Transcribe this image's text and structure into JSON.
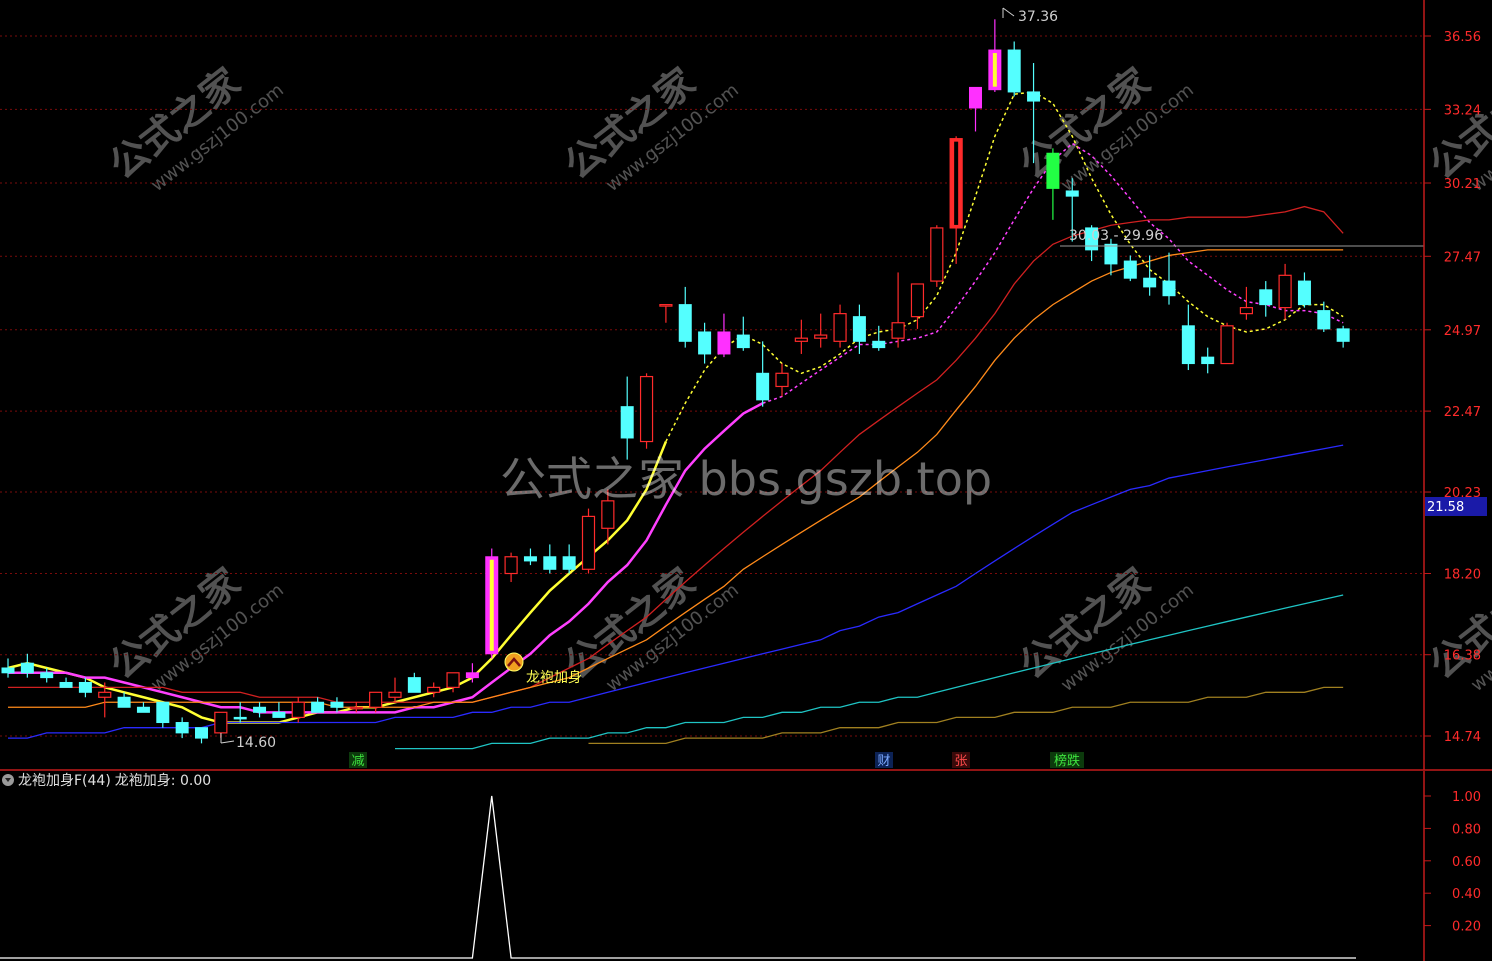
{
  "colors": {
    "background": "#000000",
    "up": "#ff2b2b",
    "down": "#54ffff",
    "dragon": "#ff30ff",
    "axis": "#c21a1a",
    "grid": "#7a0b0b",
    "ma5": "#ffff33",
    "ma10": "#ff40ff",
    "ma20": "#d02020",
    "ma30": "#ff8a1a",
    "ma60": "#2a2aff",
    "ma120": "#1fc4c4",
    "ma250": "#a08020"
  },
  "main_chart": {
    "price_axis_labels": [
      "36.56",
      "33.24",
      "30.21",
      "27.47",
      "24.97",
      "22.47",
      "20.23",
      "18.20",
      "16.38",
      "14.74"
    ],
    "current_price_tag": "21.58",
    "high_marker": "37.36",
    "low_marker": "14.60",
    "crosshair_label": "30.03 - 29.96",
    "signal_label": "龙袍加身",
    "signal_icon": "signal-arrow-up-icon",
    "event_tags": [
      {
        "text": "减",
        "color": "#1fbf1f"
      },
      {
        "text": "财",
        "color": "#2a6ad0"
      },
      {
        "text": "张",
        "color": "#d02020"
      },
      {
        "text": "榜跌",
        "color": "#1fbf1f"
      }
    ],
    "watermark_center": "公式之家 bbs.gszb.top",
    "watermark_tile_title": "公式之家",
    "watermark_tile_url": "www.gszj100.com"
  },
  "indicator_panel": {
    "toggle_icon": "chevron-down-icon",
    "name": "龙袍加身F(44)",
    "value_label": "龙袍加身: 0.00",
    "axis_labels": [
      "1.00",
      "0.80",
      "0.60",
      "0.40",
      "0.20"
    ]
  },
  "chart_data": {
    "type": "candlestick",
    "title": "",
    "xlabel": "",
    "ylabel": "",
    "ylim": [
      14.0,
      38.0
    ],
    "y_scale": "log",
    "grid": true,
    "candles": [
      {
        "o": 16.1,
        "h": 16.3,
        "l": 15.9,
        "c": 16.0,
        "kind": "down"
      },
      {
        "o": 16.2,
        "h": 16.4,
        "l": 15.9,
        "c": 16.0,
        "kind": "down"
      },
      {
        "o": 16.0,
        "h": 16.1,
        "l": 15.8,
        "c": 15.9,
        "kind": "down"
      },
      {
        "o": 15.8,
        "h": 15.9,
        "l": 15.7,
        "c": 15.7,
        "kind": "down"
      },
      {
        "o": 15.8,
        "h": 15.9,
        "l": 15.5,
        "c": 15.6,
        "kind": "down"
      },
      {
        "o": 15.6,
        "h": 15.8,
        "l": 15.1,
        "c": 15.5,
        "kind": "up"
      },
      {
        "o": 15.5,
        "h": 15.6,
        "l": 15.3,
        "c": 15.3,
        "kind": "down"
      },
      {
        "o": 15.3,
        "h": 15.4,
        "l": 15.2,
        "c": 15.2,
        "kind": "down"
      },
      {
        "o": 15.4,
        "h": 15.4,
        "l": 14.9,
        "c": 15.0,
        "kind": "down"
      },
      {
        "o": 15.0,
        "h": 15.1,
        "l": 14.7,
        "c": 14.8,
        "kind": "down"
      },
      {
        "o": 14.9,
        "h": 14.9,
        "l": 14.6,
        "c": 14.7,
        "kind": "down"
      },
      {
        "o": 14.8,
        "h": 15.2,
        "l": 14.7,
        "c": 15.2,
        "kind": "up"
      },
      {
        "o": 15.1,
        "h": 15.4,
        "l": 15.0,
        "c": 15.1,
        "kind": "down"
      },
      {
        "o": 15.3,
        "h": 15.4,
        "l": 15.1,
        "c": 15.2,
        "kind": "down"
      },
      {
        "o": 15.2,
        "h": 15.4,
        "l": 15.1,
        "c": 15.1,
        "kind": "down"
      },
      {
        "o": 15.1,
        "h": 15.5,
        "l": 15.0,
        "c": 15.4,
        "kind": "up"
      },
      {
        "o": 15.4,
        "h": 15.5,
        "l": 15.2,
        "c": 15.2,
        "kind": "down"
      },
      {
        "o": 15.4,
        "h": 15.5,
        "l": 15.2,
        "c": 15.3,
        "kind": "down"
      },
      {
        "o": 15.3,
        "h": 15.4,
        "l": 15.2,
        "c": 15.3,
        "kind": "up"
      },
      {
        "o": 15.3,
        "h": 15.6,
        "l": 15.2,
        "c": 15.6,
        "kind": "up"
      },
      {
        "o": 15.5,
        "h": 15.9,
        "l": 15.4,
        "c": 15.6,
        "kind": "up"
      },
      {
        "o": 15.9,
        "h": 16.0,
        "l": 15.6,
        "c": 15.6,
        "kind": "down"
      },
      {
        "o": 15.6,
        "h": 15.8,
        "l": 15.5,
        "c": 15.7,
        "kind": "up"
      },
      {
        "o": 15.7,
        "h": 16.0,
        "l": 15.6,
        "c": 16.0,
        "kind": "up"
      },
      {
        "o": 16.0,
        "h": 16.2,
        "l": 15.8,
        "c": 15.9,
        "kind": "dragon"
      },
      {
        "o": 16.4,
        "h": 18.8,
        "l": 16.3,
        "c": 18.6,
        "kind": "dragon"
      },
      {
        "o": 18.2,
        "h": 18.7,
        "l": 18.0,
        "c": 18.6,
        "kind": "up"
      },
      {
        "o": 18.6,
        "h": 18.8,
        "l": 18.4,
        "c": 18.5,
        "kind": "down"
      },
      {
        "o": 18.6,
        "h": 18.9,
        "l": 18.2,
        "c": 18.3,
        "kind": "down"
      },
      {
        "o": 18.6,
        "h": 18.9,
        "l": 18.2,
        "c": 18.3,
        "kind": "down"
      },
      {
        "o": 18.3,
        "h": 19.8,
        "l": 18.2,
        "c": 19.6,
        "kind": "up"
      },
      {
        "o": 19.3,
        "h": 20.3,
        "l": 18.9,
        "c": 20.0,
        "kind": "up"
      },
      {
        "o": 22.6,
        "h": 23.5,
        "l": 21.1,
        "c": 21.7,
        "kind": "down"
      },
      {
        "o": 21.6,
        "h": 23.6,
        "l": 21.4,
        "c": 23.5,
        "kind": "up"
      },
      {
        "o": 25.8,
        "h": 25.8,
        "l": 25.2,
        "c": 25.8,
        "kind": "up"
      },
      {
        "o": 25.8,
        "h": 26.4,
        "l": 24.4,
        "c": 24.6,
        "kind": "down"
      },
      {
        "o": 24.9,
        "h": 25.2,
        "l": 23.9,
        "c": 24.2,
        "kind": "down"
      },
      {
        "o": 24.2,
        "h": 25.5,
        "l": 24.1,
        "c": 24.9,
        "kind": "dragon"
      },
      {
        "o": 24.8,
        "h": 25.4,
        "l": 24.3,
        "c": 24.4,
        "kind": "down"
      },
      {
        "o": 23.6,
        "h": 24.6,
        "l": 22.6,
        "c": 22.8,
        "kind": "down"
      },
      {
        "o": 23.2,
        "h": 23.9,
        "l": 22.9,
        "c": 23.6,
        "kind": "up"
      },
      {
        "o": 24.6,
        "h": 25.3,
        "l": 24.2,
        "c": 24.7,
        "kind": "up"
      },
      {
        "o": 24.7,
        "h": 25.5,
        "l": 24.4,
        "c": 24.8,
        "kind": "up"
      },
      {
        "o": 24.6,
        "h": 25.8,
        "l": 24.4,
        "c": 25.5,
        "kind": "up"
      },
      {
        "o": 25.4,
        "h": 25.8,
        "l": 24.2,
        "c": 24.6,
        "kind": "down"
      },
      {
        "o": 24.6,
        "h": 25.1,
        "l": 24.3,
        "c": 24.4,
        "kind": "down"
      },
      {
        "o": 24.7,
        "h": 26.9,
        "l": 24.4,
        "c": 25.2,
        "kind": "up"
      },
      {
        "o": 25.4,
        "h": 26.5,
        "l": 25.0,
        "c": 26.5,
        "kind": "up"
      },
      {
        "o": 26.6,
        "h": 28.6,
        "l": 26.4,
        "c": 28.5,
        "kind": "up"
      },
      {
        "o": 28.5,
        "h": 32.1,
        "l": 27.2,
        "c": 32.0,
        "kind": "up"
      },
      {
        "o": 33.3,
        "h": 34.2,
        "l": 32.3,
        "c": 34.2,
        "kind": "dragon"
      },
      {
        "o": 34.1,
        "h": 37.36,
        "l": 34.0,
        "c": 35.9,
        "kind": "dragon"
      },
      {
        "o": 35.9,
        "h": 36.3,
        "l": 33.8,
        "c": 34.0,
        "kind": "down"
      },
      {
        "o": 34.0,
        "h": 35.3,
        "l": 31.0,
        "c": 33.6,
        "kind": "down"
      },
      {
        "o": 31.4,
        "h": 31.6,
        "l": 28.8,
        "c": 30.0,
        "kind": "green"
      },
      {
        "o": 29.9,
        "h": 30.4,
        "l": 28.0,
        "c": 29.7,
        "kind": "down"
      },
      {
        "o": 28.5,
        "h": 28.6,
        "l": 27.3,
        "c": 27.7,
        "kind": "down"
      },
      {
        "o": 27.9,
        "h": 28.1,
        "l": 26.8,
        "c": 27.2,
        "kind": "down"
      },
      {
        "o": 27.3,
        "h": 27.5,
        "l": 26.6,
        "c": 26.7,
        "kind": "down"
      },
      {
        "o": 26.7,
        "h": 27.5,
        "l": 26.1,
        "c": 26.4,
        "kind": "down"
      },
      {
        "o": 26.6,
        "h": 27.6,
        "l": 25.8,
        "c": 26.1,
        "kind": "down"
      },
      {
        "o": 25.1,
        "h": 25.8,
        "l": 23.7,
        "c": 23.9,
        "kind": "down"
      },
      {
        "o": 24.1,
        "h": 24.4,
        "l": 23.6,
        "c": 23.9,
        "kind": "down"
      },
      {
        "o": 23.9,
        "h": 25.2,
        "l": 23.9,
        "c": 25.1,
        "kind": "up"
      },
      {
        "o": 25.5,
        "h": 26.4,
        "l": 25.3,
        "c": 25.7,
        "kind": "up"
      },
      {
        "o": 25.8,
        "h": 26.6,
        "l": 25.4,
        "c": 26.3,
        "kind": "down"
      },
      {
        "o": 25.7,
        "h": 27.2,
        "l": 25.3,
        "c": 26.8,
        "kind": "up"
      },
      {
        "o": 26.6,
        "h": 26.9,
        "l": 25.7,
        "c": 25.8,
        "kind": "down"
      },
      {
        "o": 25.6,
        "h": 25.9,
        "l": 24.9,
        "c": 25.0,
        "kind": "down"
      },
      {
        "o": 25.0,
        "h": 25.1,
        "l": 24.4,
        "c": 24.6,
        "kind": "down"
      }
    ],
    "series": [
      {
        "color_key": "ma5",
        "dashed_tail_from": 35,
        "values": [
          16.1,
          16.2,
          16.1,
          16.0,
          15.9,
          15.7,
          15.6,
          15.5,
          15.4,
          15.3,
          15.1,
          15.0,
          15.0,
          15.0,
          15.0,
          15.1,
          15.2,
          15.2,
          15.3,
          15.3,
          15.4,
          15.5,
          15.6,
          15.7,
          15.9,
          16.3,
          16.8,
          17.3,
          17.8,
          18.2,
          18.6,
          19.0,
          19.5,
          20.3,
          21.6,
          22.7,
          23.7,
          24.4,
          24.8,
          24.5,
          23.9,
          23.6,
          23.8,
          24.2,
          24.7,
          24.9,
          25.0,
          25.3,
          26.1,
          27.6,
          29.7,
          32.1,
          33.9,
          34.0,
          33.5,
          32.1,
          30.4,
          29.0,
          27.9,
          27.0,
          26.5,
          25.9,
          25.4,
          25.1,
          24.9,
          25.0,
          25.3,
          25.8,
          25.8,
          25.4
        ]
      },
      {
        "color_key": "ma10",
        "dashed_tail_from": 40,
        "values": [
          16.0,
          16.0,
          16.0,
          16.0,
          15.9,
          15.9,
          15.8,
          15.7,
          15.6,
          15.5,
          15.4,
          15.3,
          15.3,
          15.2,
          15.2,
          15.2,
          15.2,
          15.2,
          15.2,
          15.2,
          15.2,
          15.3,
          15.3,
          15.4,
          15.5,
          15.8,
          16.1,
          16.4,
          16.8,
          17.1,
          17.5,
          18.0,
          18.4,
          19.0,
          19.9,
          20.8,
          21.4,
          21.9,
          22.4,
          22.7,
          22.9,
          23.3,
          23.7,
          24.1,
          24.5,
          24.5,
          24.6,
          24.7,
          24.9,
          25.7,
          26.6,
          27.6,
          28.8,
          30.0,
          31.1,
          31.8,
          31.3,
          30.5,
          29.6,
          28.7,
          28.1,
          27.3,
          26.8,
          26.3,
          25.9,
          25.8,
          25.6,
          25.6,
          25.5,
          25.2
        ]
      },
      {
        "color_key": "ma20",
        "values": [
          15.7,
          15.7,
          15.7,
          15.7,
          15.7,
          15.7,
          15.7,
          15.7,
          15.7,
          15.6,
          15.6,
          15.6,
          15.6,
          15.5,
          15.5,
          15.5,
          15.5,
          15.4,
          15.4,
          15.4,
          15.4,
          15.4,
          15.4,
          15.4,
          15.4,
          15.5,
          15.6,
          15.7,
          15.9,
          16.1,
          16.3,
          16.6,
          16.9,
          17.2,
          17.6,
          18.0,
          18.4,
          18.8,
          19.2,
          19.6,
          20.0,
          20.4,
          20.8,
          21.3,
          21.8,
          22.2,
          22.6,
          23.0,
          23.4,
          24.0,
          24.7,
          25.5,
          26.5,
          27.3,
          27.9,
          28.2,
          28.4,
          28.6,
          28.7,
          28.8,
          28.8,
          28.9,
          28.9,
          28.9,
          28.9,
          29.0,
          29.1,
          29.3,
          29.1,
          28.3
        ]
      },
      {
        "color_key": "ma30",
        "values": [
          15.3,
          15.3,
          15.3,
          15.3,
          15.3,
          15.4,
          15.4,
          15.4,
          15.4,
          15.4,
          15.4,
          15.4,
          15.4,
          15.4,
          15.4,
          15.4,
          15.4,
          15.3,
          15.3,
          15.3,
          15.3,
          15.3,
          15.4,
          15.4,
          15.4,
          15.5,
          15.6,
          15.7,
          15.8,
          15.9,
          16.1,
          16.3,
          16.5,
          16.7,
          17.0,
          17.3,
          17.6,
          17.9,
          18.3,
          18.6,
          18.9,
          19.2,
          19.5,
          19.8,
          20.1,
          20.5,
          20.9,
          21.3,
          21.8,
          22.5,
          23.2,
          24.0,
          24.7,
          25.3,
          25.8,
          26.2,
          26.6,
          26.9,
          27.1,
          27.3,
          27.5,
          27.6,
          27.7,
          27.7,
          27.7,
          27.7,
          27.7,
          27.7,
          27.7,
          27.7
        ]
      },
      {
        "color_key": "ma60",
        "values": [
          14.7,
          14.7,
          14.8,
          14.8,
          14.8,
          14.8,
          14.9,
          14.9,
          14.9,
          14.9,
          14.9,
          15.0,
          15.0,
          15.0,
          15.0,
          15.0,
          15.0,
          15.0,
          15.0,
          15.0,
          15.1,
          15.1,
          15.1,
          15.1,
          15.2,
          15.2,
          15.3,
          15.3,
          15.4,
          15.4,
          15.5,
          15.6,
          15.7,
          15.8,
          15.9,
          16.0,
          16.1,
          16.2,
          16.3,
          16.4,
          16.5,
          16.6,
          16.7,
          16.9,
          17.0,
          17.2,
          17.3,
          17.5,
          17.7,
          17.9,
          18.2,
          18.5,
          18.8,
          19.1,
          19.4,
          19.7,
          19.9,
          20.1,
          20.3,
          20.4,
          20.6,
          20.7,
          20.8,
          20.9,
          21.0,
          21.1,
          21.2,
          21.3,
          21.4,
          21.5
        ]
      },
      {
        "color_key": "ma120",
        "start": 20,
        "values": [
          14.5,
          14.5,
          14.5,
          14.5,
          14.5,
          14.6,
          14.6,
          14.6,
          14.7,
          14.7,
          14.7,
          14.8,
          14.8,
          14.9,
          14.9,
          15.0,
          15.0,
          15.0,
          15.1,
          15.1,
          15.2,
          15.2,
          15.3,
          15.3,
          15.4,
          15.4,
          15.5,
          15.5,
          15.6,
          15.7,
          15.8,
          15.9,
          16.0,
          16.1,
          16.2,
          16.3,
          16.4,
          16.5,
          16.6,
          16.7,
          16.8,
          16.9,
          17.0,
          17.1,
          17.2,
          17.3,
          17.4,
          17.5,
          17.6,
          17.7
        ]
      },
      {
        "color_key": "ma250",
        "start": 30,
        "values": [
          14.6,
          14.6,
          14.6,
          14.6,
          14.6,
          14.7,
          14.7,
          14.7,
          14.7,
          14.7,
          14.8,
          14.8,
          14.8,
          14.9,
          14.9,
          14.9,
          15.0,
          15.0,
          15.0,
          15.1,
          15.1,
          15.1,
          15.2,
          15.2,
          15.2,
          15.3,
          15.3,
          15.3,
          15.4,
          15.4,
          15.4,
          15.4,
          15.5,
          15.5,
          15.5,
          15.6,
          15.6,
          15.6,
          15.7,
          15.7
        ]
      }
    ],
    "indicator": {
      "name": "龙袍加身",
      "ylim": [
        0,
        1.0
      ],
      "values": [
        0,
        0,
        0,
        0,
        0,
        0,
        0,
        0,
        0,
        0,
        0,
        0,
        0,
        0,
        0,
        0,
        0,
        0,
        0,
        0,
        0,
        0,
        0,
        0,
        0,
        1,
        0,
        0,
        0,
        0,
        0,
        0,
        0,
        0,
        0,
        0,
        0,
        0,
        0,
        0,
        0,
        0,
        0,
        0,
        0,
        0,
        0,
        0,
        0,
        0,
        0,
        0,
        0,
        0,
        0,
        0,
        0,
        0,
        0,
        0,
        0,
        0,
        0,
        0,
        0,
        0,
        0,
        0,
        0,
        0
      ]
    }
  }
}
